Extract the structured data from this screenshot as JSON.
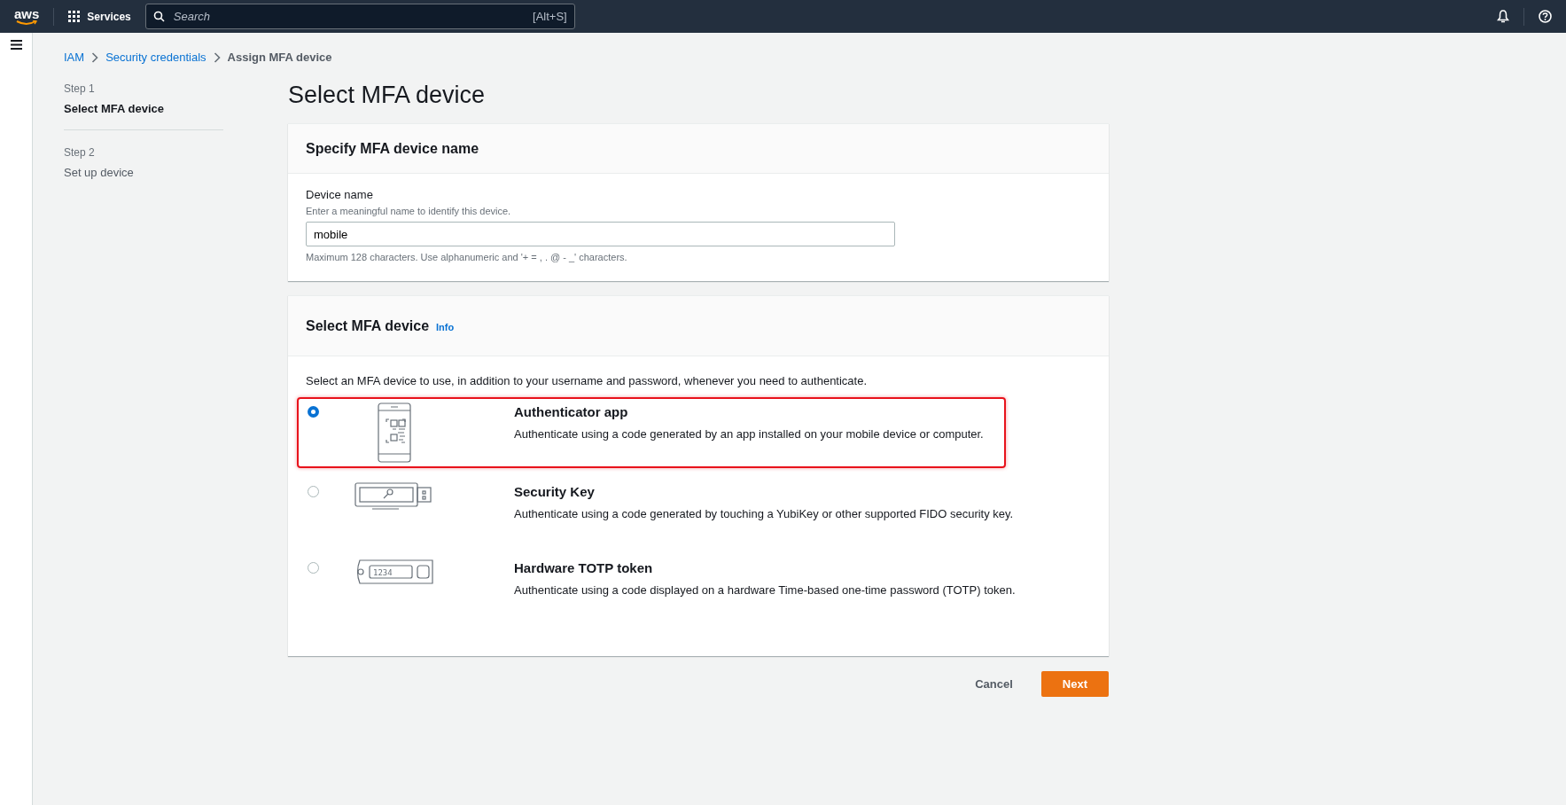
{
  "topbar": {
    "logo": "aws",
    "services": "Services",
    "search_placeholder": "Search",
    "search_shortcut": "[Alt+S]"
  },
  "breadcrumb": [
    {
      "label": "IAM",
      "link": true
    },
    {
      "label": "Security credentials",
      "link": true
    },
    {
      "label": "Assign MFA device",
      "link": false
    }
  ],
  "steps": [
    {
      "step": "Step 1",
      "label": "Select MFA device",
      "selected": true
    },
    {
      "step": "Step 2",
      "label": "Set up device",
      "selected": false
    }
  ],
  "title": "Select MFA device",
  "name_panel": {
    "heading": "Specify MFA device name",
    "field_label": "Device name",
    "description": "Enter a meaningful name to identify this device.",
    "value": "mobile",
    "constraint": "Maximum 128 characters. Use alphanumeric and '+ = , . @ - _' characters."
  },
  "device_panel": {
    "heading": "Select MFA device",
    "info": "Info",
    "intro": "Select an MFA device to use, in addition to your username and password, whenever you need to authenticate.",
    "options": [
      {
        "kind": "phone",
        "title": "Authenticator app",
        "description": "Authenticate using a code generated by an app installed on your mobile device or computer.",
        "selected": true
      },
      {
        "kind": "key",
        "title": "Security Key",
        "description": "Authenticate using a code generated by touching a YubiKey or other supported FIDO security key.",
        "selected": false
      },
      {
        "kind": "token",
        "display": "1234",
        "title": "Hardware TOTP token",
        "description": "Authenticate using a code displayed on a hardware Time-based one-time password (TOTP) token.",
        "selected": false
      }
    ]
  },
  "actions": {
    "cancel": "Cancel",
    "next": "Next"
  }
}
